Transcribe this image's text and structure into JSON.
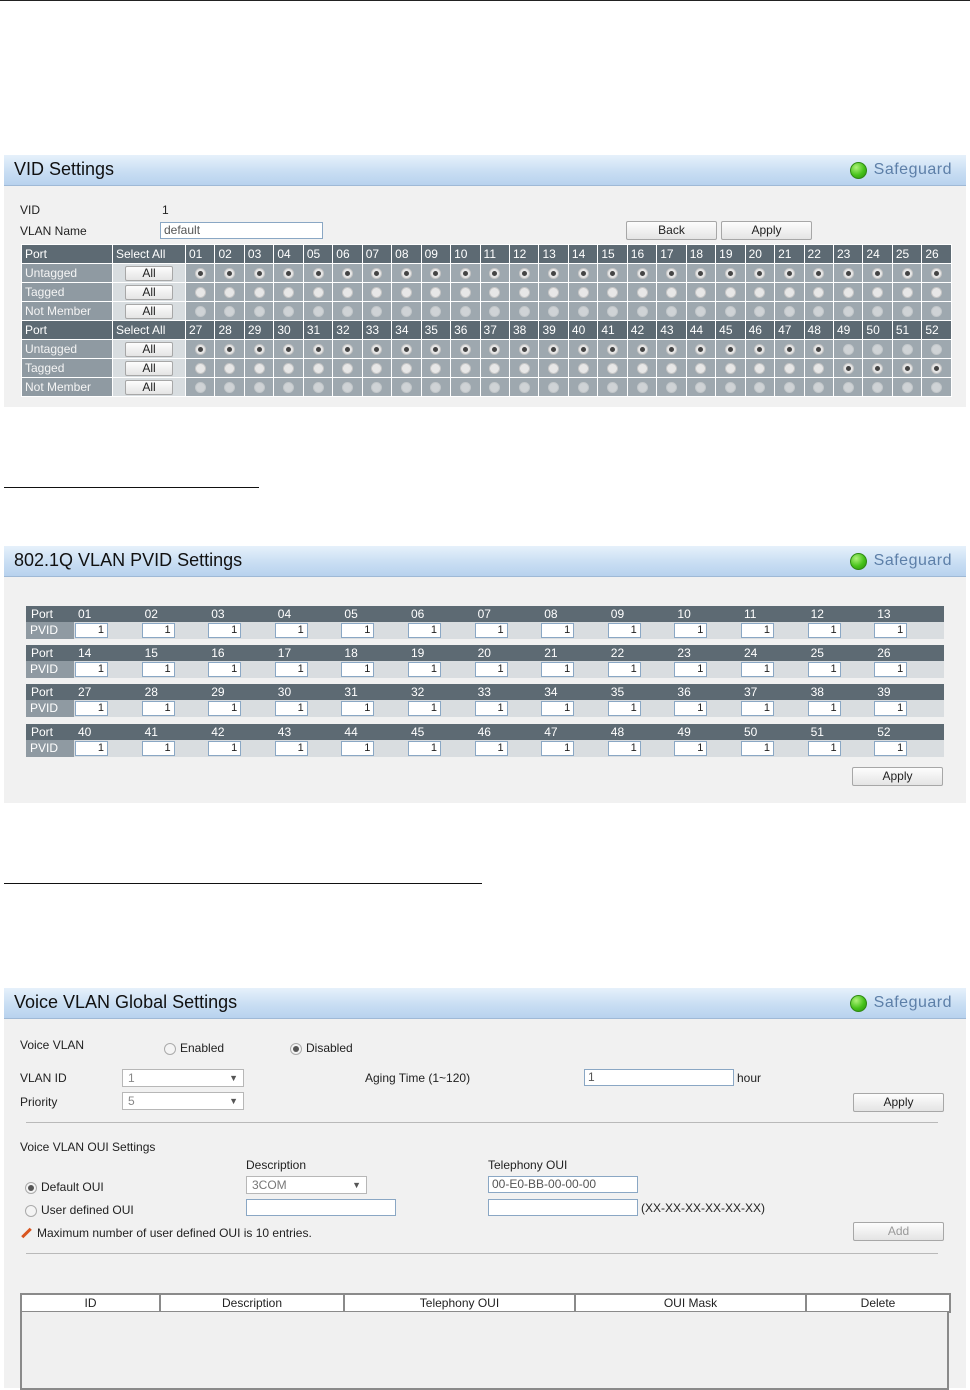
{
  "vid_settings": {
    "title": "VID Settings",
    "safeguard": "Safeguard",
    "vid_label": "VID",
    "vid_value": "1",
    "vlan_name_label": "VLAN Name",
    "vlan_name_value": "default",
    "back_label": "Back",
    "apply_label": "Apply",
    "port_header": "Port",
    "select_all_header": "Select All",
    "all_label": "All",
    "row_labels": [
      "Untagged",
      "Tagged",
      "Not Member"
    ],
    "ports_group1": [
      "01",
      "02",
      "03",
      "04",
      "05",
      "06",
      "07",
      "08",
      "09",
      "10",
      "11",
      "12",
      "13",
      "14",
      "15",
      "16",
      "17",
      "18",
      "19",
      "20",
      "21",
      "22",
      "23",
      "24",
      "25",
      "26"
    ],
    "ports_group2": [
      "27",
      "28",
      "29",
      "30",
      "31",
      "32",
      "33",
      "34",
      "35",
      "36",
      "37",
      "38",
      "39",
      "40",
      "41",
      "42",
      "43",
      "44",
      "45",
      "46",
      "47",
      "48",
      "49",
      "50",
      "51",
      "52"
    ],
    "untagged_ports_group2_count": 22
  },
  "pvid_settings": {
    "title": "802.1Q VLAN PVID Settings",
    "safeguard": "Safeguard",
    "port_label": "Port",
    "pvid_label": "PVID",
    "rows": [
      [
        "01",
        "02",
        "03",
        "04",
        "05",
        "06",
        "07",
        "08",
        "09",
        "10",
        "11",
        "12",
        "13"
      ],
      [
        "14",
        "15",
        "16",
        "17",
        "18",
        "19",
        "20",
        "21",
        "22",
        "23",
        "24",
        "25",
        "26"
      ],
      [
        "27",
        "28",
        "29",
        "30",
        "31",
        "32",
        "33",
        "34",
        "35",
        "36",
        "37",
        "38",
        "39"
      ],
      [
        "40",
        "41",
        "42",
        "43",
        "44",
        "45",
        "46",
        "47",
        "48",
        "49",
        "50",
        "51",
        "52"
      ]
    ],
    "pvid_value": "1",
    "apply_label": "Apply"
  },
  "voice_vlan": {
    "title": "Voice VLAN Global Settings",
    "safeguard": "Safeguard",
    "voice_vlan_label": "Voice VLAN",
    "enabled_label": "Enabled",
    "disabled_label": "Disabled",
    "vlan_id_label": "VLAN ID",
    "vlan_id_value": "1",
    "aging_time_label": "Aging Time (1~120)",
    "aging_time_value": "1",
    "hour_label": "hour",
    "priority_label": "Priority",
    "priority_value": "5",
    "apply_label": "Apply",
    "oui_section_label": "Voice VLAN OUI Settings",
    "description_header": "Description",
    "telephony_header": "Telephony OUI",
    "default_oui_label": "Default OUI",
    "user_oui_label": "User defined OUI",
    "default_description": "3COM",
    "default_telephony_oui": "00-E0-BB-00-00-00",
    "oui_format_hint": "(XX-XX-XX-XX-XX-XX)",
    "note": "Maximum number of user defined OUI is 10 entries.",
    "add_label": "Add",
    "table_headers": [
      "ID",
      "Description",
      "Telephony OUI",
      "OUI Mask",
      "Delete"
    ]
  }
}
